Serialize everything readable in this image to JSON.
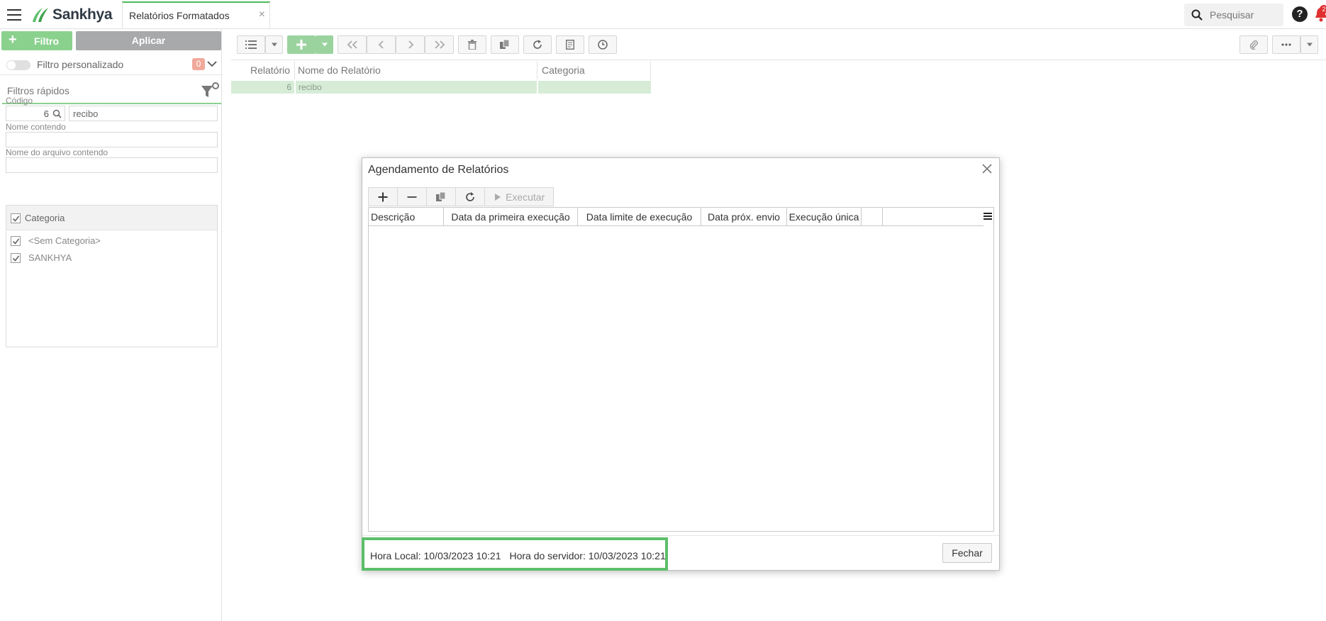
{
  "header": {
    "brand": "Sankhya",
    "tab_title": "Relatórios Formatados",
    "search_placeholder": "Pesquisar",
    "notifications_badge": "2"
  },
  "sidebar": {
    "filtro_button": "Filtro",
    "aplicar_button": "Aplicar",
    "custom_filter_label": "Filtro personalizado",
    "custom_filter_count": "0",
    "quick_filters_title": "Filtros rápidos",
    "codigo_label": "Código",
    "codigo_value": "6",
    "codigo_name_value": "recibo",
    "nome_contendo_label": "Nome contendo",
    "nome_contendo_value": "",
    "arquivo_label": "Nome do arquivo contendo",
    "arquivo_value": "",
    "categoria_label": "Categoria",
    "categorias": [
      "<Sem Categoria>",
      "SANKHYA"
    ]
  },
  "grid": {
    "columns": [
      "Relatório",
      "Nome do Relatório",
      "Categoria"
    ],
    "rows": [
      {
        "relatorio": "6",
        "nome": "recibo",
        "categoria": ""
      }
    ]
  },
  "modal": {
    "title": "Agendamento de Relatórios",
    "execute_label": "Executar",
    "columns": [
      "Descrição",
      "Data da primeira execução",
      "Data limite de execução",
      "Data próx. envio",
      "Execução única"
    ],
    "hora_local": "Hora Local: 10/03/2023 10:21",
    "hora_servidor": "Hora do servidor: 10/03/2023 10:21",
    "close_button": "Fechar"
  },
  "colors": {
    "accent_green": "#4cbb5a",
    "light_green": "#8bd18e",
    "selected_row": "#d6ecd7",
    "highlight_box": "#5cbf6a"
  }
}
